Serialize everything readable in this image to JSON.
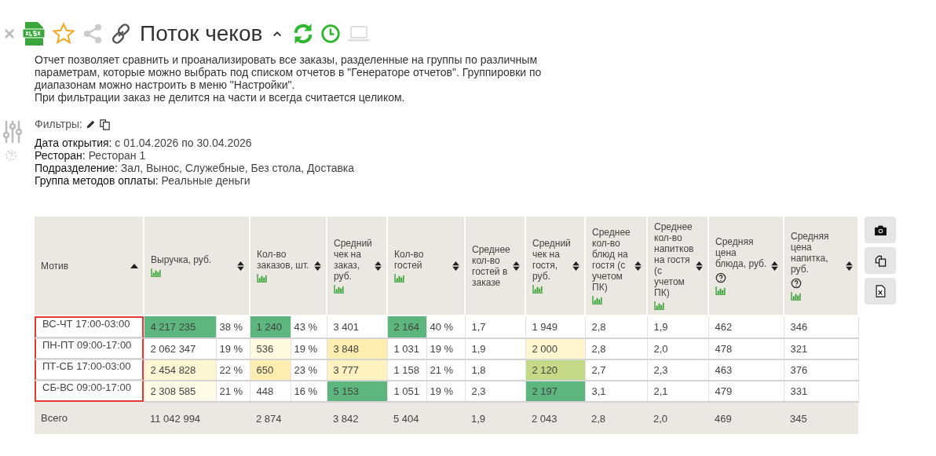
{
  "title": "Поток чеков",
  "description": [
    "Отчет позволяет сравнить и проанализировать все заказы, разделенные на группы по различным параметрам, которые можно выбрать под списком отчетов в \"Генераторе отчетов\". Группировки по диапазонам можно настроить в меню \"Настройки\".",
    "При фильтрации заказ не делится на части и всегда считается целиком."
  ],
  "filters": {
    "label": "Фильтры:",
    "lines": [
      "**Дата открытия:** с 01.04.2026 по 30.04.2026",
      "**Ресторан:** Ресторан 1",
      "**Подразделение:** Зал, Вынос, Служебные, Без стола, Доставка",
      "**Группа методов оплаты:** Реальные деньги"
    ]
  },
  "table": {
    "motif_highlighted": true,
    "columns": [
      {
        "label": "Мотив",
        "sorted": true,
        "chart": false,
        "help": false,
        "pct": false
      },
      {
        "label": "Выручка, руб.",
        "sorted": false,
        "chart": true,
        "help": false,
        "pct": true
      },
      {
        "label": "Кол-во заказов, шт.",
        "sorted": false,
        "chart": true,
        "help": false,
        "pct": true
      },
      {
        "label": "Средний чек на заказ, руб.",
        "sorted": false,
        "chart": true,
        "help": false,
        "pct": false
      },
      {
        "label": "Кол-во гостей",
        "sorted": false,
        "chart": true,
        "help": false,
        "pct": true
      },
      {
        "label": "Среднее кол-во гостей в заказе",
        "sorted": false,
        "chart": false,
        "help": false,
        "pct": false
      },
      {
        "label": "Средний чек на гостя, руб.",
        "sorted": false,
        "chart": true,
        "help": false,
        "pct": false
      },
      {
        "label": "Среднее кол-во блюд на гостя (с учетом ПК)",
        "sorted": false,
        "chart": true,
        "help": false,
        "pct": false
      },
      {
        "label": "Среднее кол-во напитков на гостя (с учетом ПК)",
        "sorted": false,
        "chart": true,
        "help": false,
        "pct": false
      },
      {
        "label": "Средняя цена блюда, руб.",
        "sorted": false,
        "chart": true,
        "help": true,
        "pct": false
      },
      {
        "label": "Средняя цена напитка, руб.",
        "sorted": false,
        "chart": true,
        "help": true,
        "pct": false
      }
    ],
    "rows": [
      {
        "cells": [
          {
            "value": "ВС-ЧТ 17:00-03:00"
          },
          {
            "value": "4 217 235",
            "pct": "38 %",
            "color": "#5cb67d"
          },
          {
            "value": "1 240",
            "pct": "43 %",
            "color": "#5cb67d"
          },
          {
            "value": "3 401"
          },
          {
            "value": "2 164",
            "pct": "40 %",
            "color": "#5cb67d"
          },
          {
            "value": "1,7"
          },
          {
            "value": "1 949"
          },
          {
            "value": "2,8"
          },
          {
            "value": "1,9"
          },
          {
            "value": "462"
          },
          {
            "value": "346"
          }
        ]
      },
      {
        "cells": [
          {
            "value": "ПН-ПТ 09:00-17:00"
          },
          {
            "value": "2 062 347",
            "pct": "19 %"
          },
          {
            "value": "536",
            "pct": "19 %",
            "color": "#fffadf"
          },
          {
            "value": "3 848",
            "color": "#fdeeb0"
          },
          {
            "value": "1 031",
            "pct": "19 %"
          },
          {
            "value": "1,9"
          },
          {
            "value": "2 000",
            "color": "#fff6cf"
          },
          {
            "value": "2,8"
          },
          {
            "value": "2,0"
          },
          {
            "value": "478"
          },
          {
            "value": "321"
          }
        ]
      },
      {
        "cells": [
          {
            "value": "ПТ-СБ 17:00-03:00"
          },
          {
            "value": "2 454 828",
            "pct": "22 %",
            "color": "#fef5d2"
          },
          {
            "value": "650",
            "pct": "23 %",
            "color": "#fdeeaf"
          },
          {
            "value": "3 777",
            "color": "#fef2c0"
          },
          {
            "value": "1 158",
            "pct": "21 %"
          },
          {
            "value": "1,8"
          },
          {
            "value": "2 120",
            "color": "#c4da86"
          },
          {
            "value": "2,7"
          },
          {
            "value": "2,3"
          },
          {
            "value": "463"
          },
          {
            "value": "376"
          }
        ]
      },
      {
        "cells": [
          {
            "value": "СБ-ВС 09:00-17:00"
          },
          {
            "value": "2 308 585",
            "pct": "21 %",
            "color": "#fffbe6"
          },
          {
            "value": "448",
            "pct": "16 %"
          },
          {
            "value": "5 153",
            "color": "#5cb67d"
          },
          {
            "value": "1 051",
            "pct": "19 %"
          },
          {
            "value": "2,3"
          },
          {
            "value": "2 197",
            "color": "#5cb67d"
          },
          {
            "value": "3,1"
          },
          {
            "value": "2,1"
          },
          {
            "value": "479"
          },
          {
            "value": "331"
          }
        ]
      }
    ],
    "total": [
      "Всего",
      "11 042 994",
      "2 874",
      "3 842",
      "5 404",
      "1,9",
      "2 043",
      "2,8",
      "2,0",
      "469",
      "345"
    ]
  }
}
